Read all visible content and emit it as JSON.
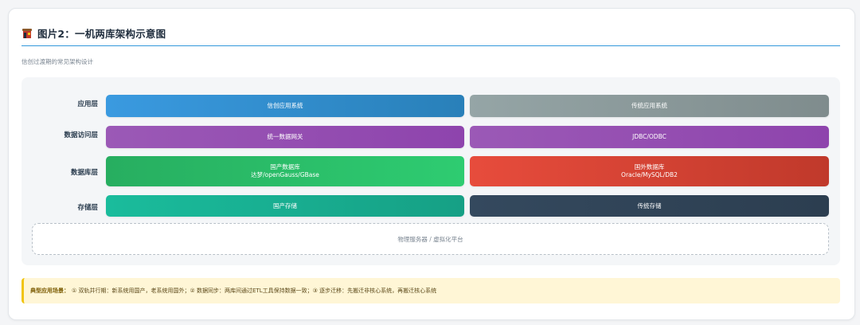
{
  "title": "图片2：一机两库架构示意图",
  "subtitle": "信创过渡期的常见架构设计",
  "icon": "database-building-icon",
  "colors": {
    "accent": "#3498db",
    "app_xinchuang": "#2980b9",
    "app_traditional": "#7f8c8d",
    "data_access": "#8e44ad",
    "domestic_db": "#2ecc71",
    "foreign_db": "#e74c3c",
    "domestic_storage": "#16a085",
    "traditional_storage": "#2c3e50"
  },
  "layers": [
    {
      "label": "应用层",
      "left": [
        "信创应用系统"
      ],
      "right": [
        "传统应用系统"
      ]
    },
    {
      "label": "数据访问层",
      "left": [
        "统一数据网关"
      ],
      "right": [
        "JDBC/ODBC"
      ]
    },
    {
      "label": "数据库层",
      "left": [
        "国产数据库",
        "达梦/openGauss/GBase"
      ],
      "right": [
        "国外数据库",
        "Oracle/MySQL/DB2"
      ]
    },
    {
      "label": "存储层",
      "left": [
        "国产存储"
      ],
      "right": [
        "传统存储"
      ]
    }
  ],
  "platform": "物理服务器 / 虚拟化平台",
  "scenario": {
    "label": "典型应用场景：",
    "text": "① 双轨并行期：新系统用国产，老系统用国外；② 数据同步：两库间通过ETL工具保持数据一致；③ 逐步迁移：先搬迁非核心系统，再搬迁核心系统"
  }
}
